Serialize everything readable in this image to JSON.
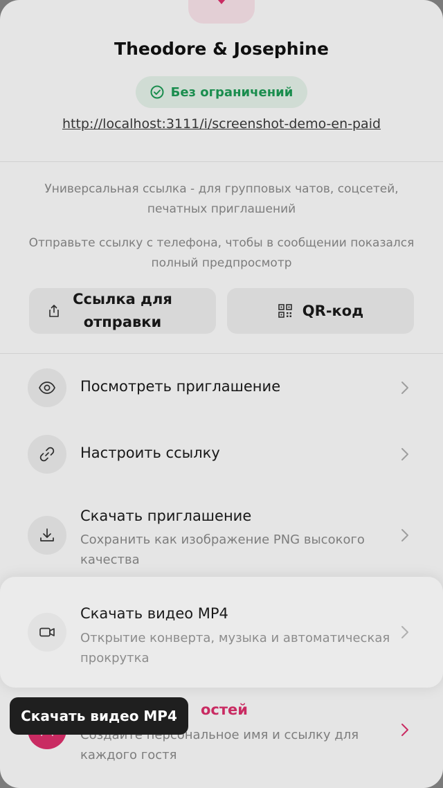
{
  "invite": {
    "title": "Theodore & Josephine",
    "badge_label": "Без ограничений",
    "url": "http://localhost:3111/i/screenshot-demo-en-paid"
  },
  "hints": {
    "universal": "Универсальная ссылка - для групповых чатов, соцсетей, печатных приглашений",
    "send_from_phone": "Отправьте ссылку с телефона, чтобы в сообщении показался полный предпросмотр"
  },
  "actions": {
    "share_link_line1": "Ссылка для",
    "share_link_line2": "отправки",
    "qr_label": "QR-код"
  },
  "menu": {
    "view": {
      "title": "Посмотреть приглашение"
    },
    "customize": {
      "title": "Настроить ссылку"
    },
    "download_image": {
      "title": "Скачать приглашение",
      "subtitle": "Сохранить как изображение PNG высокого качества"
    },
    "download_video": {
      "title": "Скачать видео MP4",
      "subtitle": "Открытие конверта, музыка и автоматическая прокрутка"
    },
    "guests": {
      "title_partial": "остей",
      "subtitle": "Создайте персональное имя и ссылку для каждого гостя"
    }
  },
  "tooltip": {
    "label": "Скачать видео MP4"
  },
  "colors": {
    "badge_green": "#1e9e57",
    "badge_bg": "#e8f5ec",
    "accent_pink": "#e0306e",
    "tooltip_bg": "#1f1f1f"
  },
  "icons": {
    "top": "heart-icon",
    "badge": "check-circle-icon",
    "share": "share-icon",
    "qr": "qr-code-icon",
    "view": "eye-icon",
    "customize": "link-icon",
    "download_image": "download-icon",
    "download_video": "video-camera-icon",
    "guests": "guests-icon",
    "chevron": "chevron-right-icon"
  }
}
